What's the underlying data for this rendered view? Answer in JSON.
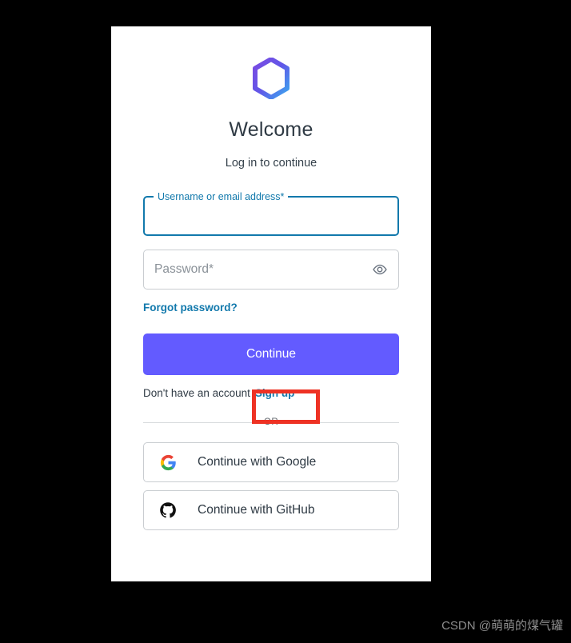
{
  "card": {
    "logo_icon": "hexagon-logo-icon",
    "title": "Welcome",
    "subtitle": "Log in to continue"
  },
  "form": {
    "username": {
      "label": "Username or email address*",
      "value": "",
      "placeholder": ""
    },
    "password": {
      "placeholder": "Password*",
      "value": "",
      "toggle_icon": "eye-icon"
    },
    "forgot_password_label": "Forgot password?",
    "continue_label": "Continue",
    "signup_prompt": "Don't have an account",
    "signup_label": "Sign up"
  },
  "divider": {
    "or_label": "OR"
  },
  "social": [
    {
      "label": "Continue with Google",
      "icon": "google-icon"
    },
    {
      "label": "Continue with GitHub",
      "icon": "github-icon"
    }
  ],
  "watermark": {
    "text": "CSDN @萌萌的煤气罐"
  },
  "colors": {
    "accent_link": "#1279ac",
    "primary_button": "#635bff",
    "focus_border": "#1279ac",
    "annotation": "#ee3224",
    "logo_gradient_start": "#7b4ae2",
    "logo_gradient_end": "#3ba8ef"
  }
}
